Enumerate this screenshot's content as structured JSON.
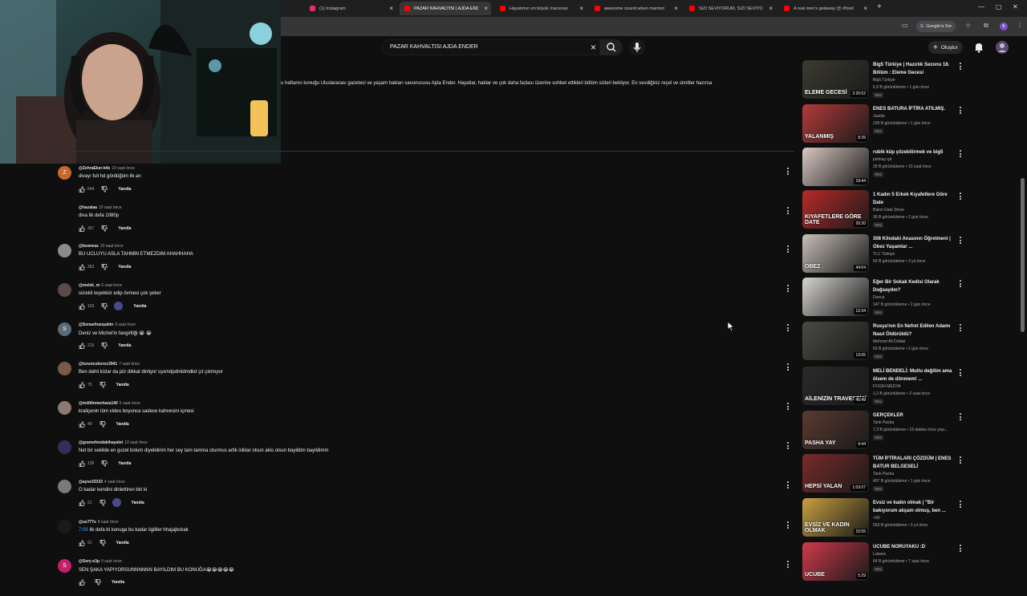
{
  "browser": {
    "tabs": [
      {
        "title": "(1) Instagram",
        "icon": "instagram-icon",
        "color": "#e1306c",
        "active": false
      },
      {
        "title": "PAZAR KAHVALTISI | AJDA ENDER",
        "icon": "youtube-icon",
        "color": "#ff0000",
        "active": true
      },
      {
        "title": "Hayatımın en büyük macerası",
        "icon": "youtube-icon",
        "color": "#ff0000",
        "active": false
      },
      {
        "title": "awesome sound when marmot",
        "icon": "youtube-icon",
        "color": "#ff0000",
        "active": false
      },
      {
        "title": "SİZİ SEVİYORUM, SİZİ SEVİYORUM",
        "icon": "youtube-icon",
        "color": "#ff0000",
        "active": false
      },
      {
        "title": "A real men's getaway 😍 #food",
        "icon": "youtube-icon",
        "color": "#ff0000",
        "active": false
      }
    ],
    "google_search_label": "Google'a Sor",
    "profile_initial": "k"
  },
  "youtube": {
    "search_value": "PAZAR KAHVALTISI AJDA ENDER",
    "create_label": "Oluştur",
    "description": "u haftanın konuğu Uluslararası gazeteci ve yaşam hakları savunucusu Ajda Ender. Hayatlar, haklar ve çok daha fazlası üzerine sohbet ettikleri bölüm sizleri bekliyor. En sevdiğiniz reçel ve simitler hazırsa",
    "reply_label": "Yanıtla",
    "accent": "#3ea6ff"
  },
  "comments": [
    {
      "user": "@ZehraEker-k4s",
      "ago": "10 saat önce",
      "text": "divayı full hd gördüğüm ilk an",
      "likes": "644",
      "avatar_letter": "Z",
      "avatar_color": "#c9682b",
      "heart": false
    },
    {
      "user": "@hazalaa",
      "ago": "10 saat önce",
      "text": "diva ilk defa 1080p",
      "likes": "357",
      "avatar_letter": "",
      "avatar_color": "#0f0f0f",
      "heart": false
    },
    {
      "user": "@bewreas",
      "ago": "10 saat önce",
      "text": "BU UCLUYU ASLA TAHMIN ETMEZDIM AHAHHAHA",
      "likes": "363",
      "avatar_letter": "",
      "avatar_color": "#8b8b8b",
      "heart": false
    },
    {
      "user": "@melek_m",
      "ago": "6 saat önce",
      "text": "sürekli teşekkür edip övmesi çok şeker",
      "likes": "103",
      "avatar_letter": "",
      "avatar_color": "#5b4a48",
      "heart": true
    },
    {
      "user": "@Senaefnanşahin",
      "ago": "9 saat önce",
      "text": "Deniz ve Michel'in fangirlliği 😭 😭",
      "likes": "215",
      "avatar_letter": "S",
      "avatar_color": "#5a6a78",
      "heart": false
    },
    {
      "user": "@turuncuhoroz3941",
      "ago": "7 saat önce",
      "text": "Ben dahil kizlar da pür dikkat dinliyor sşxmdpdmldmdkd çıt çıkmıyor",
      "likes": "75",
      "avatar_letter": "",
      "avatar_color": "#7a5a45",
      "heart": false
    },
    {
      "user": "@mılitlinmerkara140",
      "ago": "5 saat önce",
      "text": "kraliçenin tüm video boyunca sadece kahvesini içmesi",
      "likes": "49",
      "avatar_letter": "",
      "avatar_color": "#8a7a70",
      "heart": false
    },
    {
      "user": "@gramofondakihayalet",
      "ago": "10 saat önce",
      "text": "Net bir sekilde en guzel bolum diyebilirim her sey tam tamina oturmus artik islklar olsun akis olsun bayildim bayildimm",
      "likes": "139",
      "avatar_letter": "",
      "avatar_color": "#3a2a5a",
      "heart": false
    },
    {
      "user": "@ayse33333",
      "ago": "4 saat önce",
      "text": "O kadar kendini dinlettiren biri ki",
      "likes": "21",
      "avatar_letter": "",
      "avatar_color": "#7a7a7a",
      "heart": true
    },
    {
      "user": "@us777s",
      "ago": "8 saat önce",
      "text": "ilk defa bi konuga bu kadar ilgililer hhajajkckak",
      "timestamp": "7:09",
      "likes": "91",
      "avatar_letter": "",
      "avatar_color": "#1a1a1a",
      "heart": false
    },
    {
      "user": "@Sery-e3p",
      "ago": "9 saat önce",
      "text": "SEN ŞAKA YAPIYORSUNNNNNN BAYILDIM BU KONUĞA😭😭😭😭😭",
      "likes": "",
      "avatar_letter": "S",
      "avatar_color": "#c4206a",
      "heart": false
    }
  ],
  "videos": [
    {
      "title": "Big5 Türkiye | Hazırlık Sezonu 18. Bölüm : Eleme Gecesi",
      "channel": "Big5 Türkiye",
      "meta": "6,9 B görüntüleme • 1 gün önce",
      "new": "Yeni",
      "duration": "2:20:02",
      "thumb_text": "ELEME GECESİ",
      "thumb_color": "#3b3b30"
    },
    {
      "title": "ENES BATURA İFTİRA ATILMIŞ.",
      "channel": "Juadia",
      "meta": "239 B görüntüleme • 1 gün önce",
      "new": "Yeni",
      "duration": "8:39",
      "thumb_text": "YALANMIŞ",
      "thumb_color": "#b53a3a"
    },
    {
      "title": "rubik küp çözebilirmek ve big5",
      "channel": "pelinay işit",
      "meta": "39 B görüntüleme • 10 saat önce",
      "new": "Yeni",
      "duration": "19:44",
      "thumb_text": "",
      "thumb_color": "#d8c8c0"
    },
    {
      "title": "1 Kadın 5 Erkek Kıyafetlere Göre Date",
      "channel": "Balon Date Show",
      "meta": "36 B görüntüleme • 2 gün önce",
      "new": "Yeni",
      "duration": "20:20",
      "thumb_text": "KIYAFETLERE GÖRE DATE",
      "thumb_color": "#b82a2a"
    },
    {
      "title": "308 Kilodaki Anasının Öğretmeni | Obez Yaşamlar ...",
      "channel": "TLC Türkiye",
      "meta": "69 B görüntüleme • 3 yıl önce",
      "new": "",
      "duration": "44:04",
      "thumb_text": "OBEZ",
      "thumb_color": "#c8c0b8"
    },
    {
      "title": "Eğer Bir Sokak Kedisi Olarak Doğsaydın?",
      "channel": "Donca",
      "meta": "147 B görüntüleme • 2 gün önce",
      "new": "Yeni",
      "duration": "12:34",
      "thumb_text": "",
      "thumb_color": "#d6d4d0"
    },
    {
      "title": "Rusya'nın En Nefret Edilen Adamı Nasıl Öldürüldü?",
      "channel": "Mehmet Ali Doldal",
      "meta": "59 B görüntüleme • 2 gün önce",
      "new": "Yeni",
      "duration": "13:05",
      "thumb_text": "",
      "thumb_color": "#4a4a44"
    },
    {
      "title": "MELİ BENDELİ: Mutlu değilim ama ölsem de dönmem! ...",
      "channel": "FOGNI MEDYA",
      "meta": "1,2 B görüntüleme • 2 saat önce",
      "new": "Yeni",
      "duration": "45:49",
      "thumb_text": "AİLENİZİN TRAVESTİSİ",
      "thumb_color": "#2a2a2a"
    },
    {
      "title": "GERÇEKLER",
      "channel": "Tank Pasha",
      "meta": "7,3 B görüntüleme • 19 dakika önce yayı...",
      "new": "Yeni",
      "duration": "9:44",
      "thumb_text": "PASHA YAY",
      "thumb_color": "#5a3a30"
    },
    {
      "title": "TÜM İFTİRALARI ÇÖZDÜM | ENES BATUR BELGESELİ",
      "channel": "Tank Pasha",
      "meta": "407 B görüntüleme • 1 gün önce",
      "new": "Yeni",
      "duration": "1:03:07",
      "thumb_text": "HEPSİ YALAN",
      "thumb_color": "#7a2a2a"
    },
    {
      "title": "Evsiz ve kadın olmak | \"Bir bakıyorum akşam olmuş, ben ...",
      "channel": "+90",
      "meta": "553 B görüntüleme • 3 yıl önce",
      "new": "",
      "duration": "15:55",
      "thumb_text": "EVSİZ VE KADIN OLMAK",
      "thumb_color": "#c8a040"
    },
    {
      "title": "UCUBE NORUYAKU :D",
      "channel": "Lukanz",
      "meta": "64 B görüntüleme • 7 saat önce",
      "new": "Yeni",
      "duration": "5:29",
      "thumb_text": "UCUBE",
      "thumb_color": "#d03a4a"
    }
  ]
}
